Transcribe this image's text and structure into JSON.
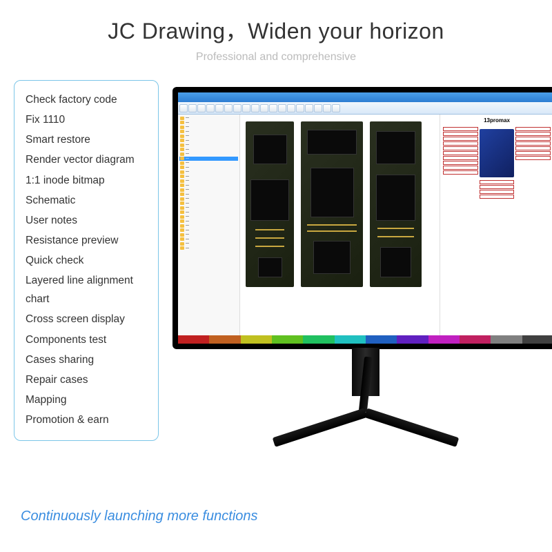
{
  "header": {
    "title": "JC Drawing，Widen your horizon",
    "subtitle": "Professional and comprehensive"
  },
  "features": [
    "Check factory code",
    "Fix 1110",
    "Smart restore",
    "Render vector diagram",
    "1:1 inode bitmap",
    "Schematic",
    "User notes",
    "Resistance preview",
    "Quick check",
    "Layered line alignment chart",
    "Cross screen display",
    "Components test",
    "Cases sharing",
    "Repair cases",
    "Mapping",
    "Promotion & earn"
  ],
  "footer": "Continuously launching more functions",
  "app": {
    "right_title": "13promax",
    "color_bar": [
      "#c02020",
      "#c06020",
      "#c0c020",
      "#60c020",
      "#20c060",
      "#20c0c0",
      "#2060c0",
      "#6020c0",
      "#c020c0",
      "#c02060",
      "#808080",
      "#404040"
    ]
  }
}
